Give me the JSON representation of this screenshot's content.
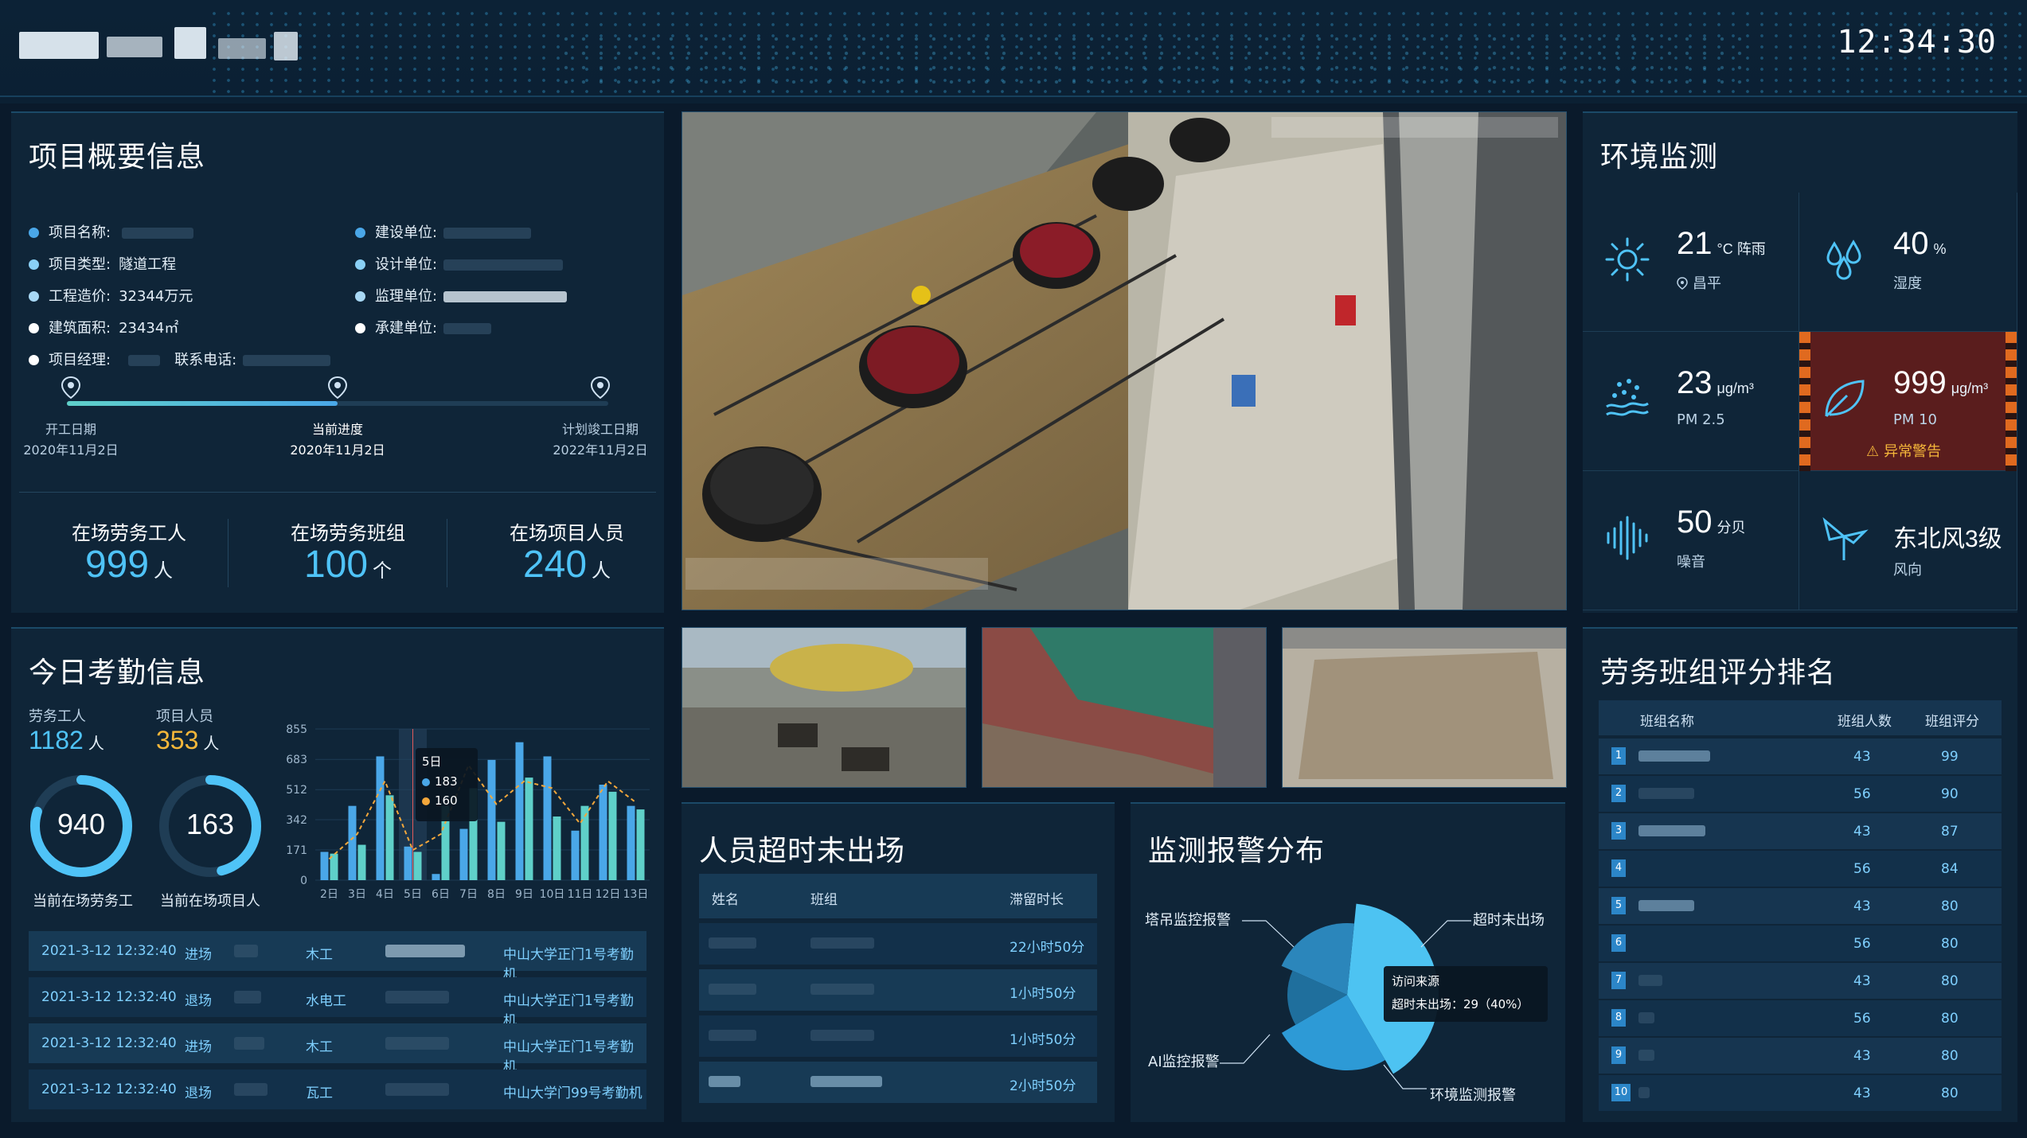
{
  "header": {
    "clock": "12:34:30"
  },
  "overview": {
    "title": "项目概要信息",
    "left_items": [
      {
        "label": "项目名称:",
        "value": "",
        "dot": "#4aa7e8"
      },
      {
        "label": "项目类型:",
        "value": "隧道工程",
        "dot": "#8ad0f5"
      },
      {
        "label": "工程造价:",
        "value": "32344万元",
        "dot": "#a8d8f5"
      },
      {
        "label": "建筑面积:",
        "value": "23434㎡",
        "dot": "#ffffff"
      },
      {
        "label": "项目经理:",
        "value": "",
        "dot": "#ffffff"
      }
    ],
    "phone_label": "联系电话:",
    "right_items": [
      {
        "label": "建设单位:",
        "value": "",
        "dot": "#4aa7e8"
      },
      {
        "label": "设计单位:",
        "value": "",
        "dot": "#8ad0f5"
      },
      {
        "label": "监理单位:",
        "value": "",
        "dot": "#a8d8f5"
      },
      {
        "label": "承建单位:",
        "value": "",
        "dot": "#ffffff"
      }
    ],
    "timeline": {
      "progress": 0.5,
      "points": [
        {
          "label": "开工日期",
          "date": "2020年11月2日"
        },
        {
          "label": "当前进度",
          "date": "2020年11月2日"
        },
        {
          "label": "计划竣工日期",
          "date": "2022年11月2日"
        }
      ]
    },
    "stats": [
      {
        "label": "在场劳务工人",
        "value": "999",
        "unit": "人"
      },
      {
        "label": "在场劳务班组",
        "value": "100",
        "unit": "个"
      },
      {
        "label": "在场项目人员",
        "value": "240",
        "unit": "人"
      }
    ]
  },
  "attendance": {
    "title": "今日考勤信息",
    "workers_label": "劳务工人",
    "workers_value": "1182",
    "staff_label": "项目人员",
    "staff_value": "353",
    "unit": "人",
    "ring1": {
      "value": "940",
      "label": "当前在场劳务工",
      "fraction": 0.8
    },
    "ring2": {
      "value": "163",
      "label": "当前在场项目人",
      "fraction": 0.46
    },
    "tooltip": {
      "title": "5日",
      "s1": "183",
      "s2": "160"
    },
    "records": [
      {
        "time": "2021-3-12 12:32:40",
        "dir": "进场",
        "team": "木工",
        "gate": "中山大学正门1号考勤机"
      },
      {
        "time": "2021-3-12 12:32:40",
        "dir": "退场",
        "team": "水电工",
        "gate": "中山大学正门1号考勤机"
      },
      {
        "time": "2021-3-12 12:32:40",
        "dir": "进场",
        "team": "木工",
        "gate": "中山大学正门1号考勤机"
      },
      {
        "time": "2021-3-12 12:32:40",
        "dir": "退场",
        "team": "瓦工",
        "gate": "中山大学门99号考勤机"
      }
    ]
  },
  "chart_data": {
    "type": "bar",
    "categories": [
      "2日",
      "3日",
      "4日",
      "5日",
      "6日",
      "7日",
      "8日",
      "9日",
      "10日",
      "11日",
      "12日",
      "13日"
    ],
    "yticks": [
      "0",
      "171",
      "342",
      "512",
      "683",
      "855"
    ],
    "ylim": [
      0,
      855
    ],
    "series": [
      {
        "values": [
          160,
          420,
          700,
          190,
          35,
          290,
          680,
          780,
          700,
          280,
          540,
          420
        ],
        "color": "#4aa7e8"
      },
      {
        "values": [
          150,
          200,
          480,
          160,
          420,
          520,
          330,
          580,
          360,
          420,
          500,
          400
        ],
        "color": "#5fd0c9"
      }
    ],
    "line": {
      "values": [
        120,
        260,
        560,
        170,
        260,
        650,
        430,
        560,
        520,
        320,
        560,
        440
      ],
      "color": "#f3a73b"
    }
  },
  "environment": {
    "title": "环境监测",
    "cells": [
      {
        "icon": "sun-icon",
        "value": "21",
        "unit": "°C 阵雨",
        "sub": "昌平"
      },
      {
        "icon": "humidity-icon",
        "value": "40",
        "unit": "%",
        "sub": "湿度"
      },
      {
        "icon": "pm25-icon",
        "value": "23",
        "unit": "μg/m³",
        "sub": "PM 2.5"
      },
      {
        "icon": "leaf-icon",
        "value": "999",
        "unit": "μg/m³",
        "sub": "PM 10",
        "warning": "异常警告"
      },
      {
        "icon": "noise-icon",
        "value": "50",
        "unit": "分贝",
        "sub": "噪音"
      },
      {
        "icon": "wind-icon",
        "value": "东北风3级",
        "unit": "",
        "sub": "风向"
      }
    ]
  },
  "overtime": {
    "title": "人员超时未出场",
    "headers": [
      "姓名",
      "班组",
      "滞留时长"
    ],
    "rows": [
      {
        "duration": "22小时50分"
      },
      {
        "duration": "1小时50分"
      },
      {
        "duration": "1小时50分"
      },
      {
        "duration": "2小时50分"
      }
    ]
  },
  "alarm": {
    "title": "监测报警分布",
    "labels": [
      "塔吊监控报警",
      "超时未出场",
      "AI监控报警",
      "环境监测报警"
    ],
    "tooltip_title": "访问来源",
    "tooltip_text": "超时未出场：29（40%）",
    "pie": [
      {
        "name": "超时未出场",
        "value": 40,
        "color": "#4dc3f2"
      },
      {
        "name": "环境监测报警",
        "value": 25,
        "color": "#2d9ad6"
      },
      {
        "name": "AI监控报警",
        "value": 15,
        "color": "#1f6f9d"
      },
      {
        "name": "塔吊监控报警",
        "value": 20,
        "color": "#2b86bb"
      }
    ]
  },
  "ranking": {
    "title": "劳务班组评分排名",
    "headers": [
      "班组名称",
      "班组人数",
      "班组评分"
    ],
    "rows": [
      {
        "rank": "1",
        "count": "43",
        "score": "99"
      },
      {
        "rank": "2",
        "count": "56",
        "score": "90"
      },
      {
        "rank": "3",
        "count": "43",
        "score": "87"
      },
      {
        "rank": "4",
        "count": "56",
        "score": "84"
      },
      {
        "rank": "5",
        "count": "43",
        "score": "80"
      },
      {
        "rank": "6",
        "count": "56",
        "score": "80"
      },
      {
        "rank": "7",
        "count": "43",
        "score": "80"
      },
      {
        "rank": "8",
        "count": "56",
        "score": "80"
      },
      {
        "rank": "9",
        "count": "43",
        "score": "80"
      },
      {
        "rank": "10",
        "count": "43",
        "score": "80"
      }
    ]
  }
}
